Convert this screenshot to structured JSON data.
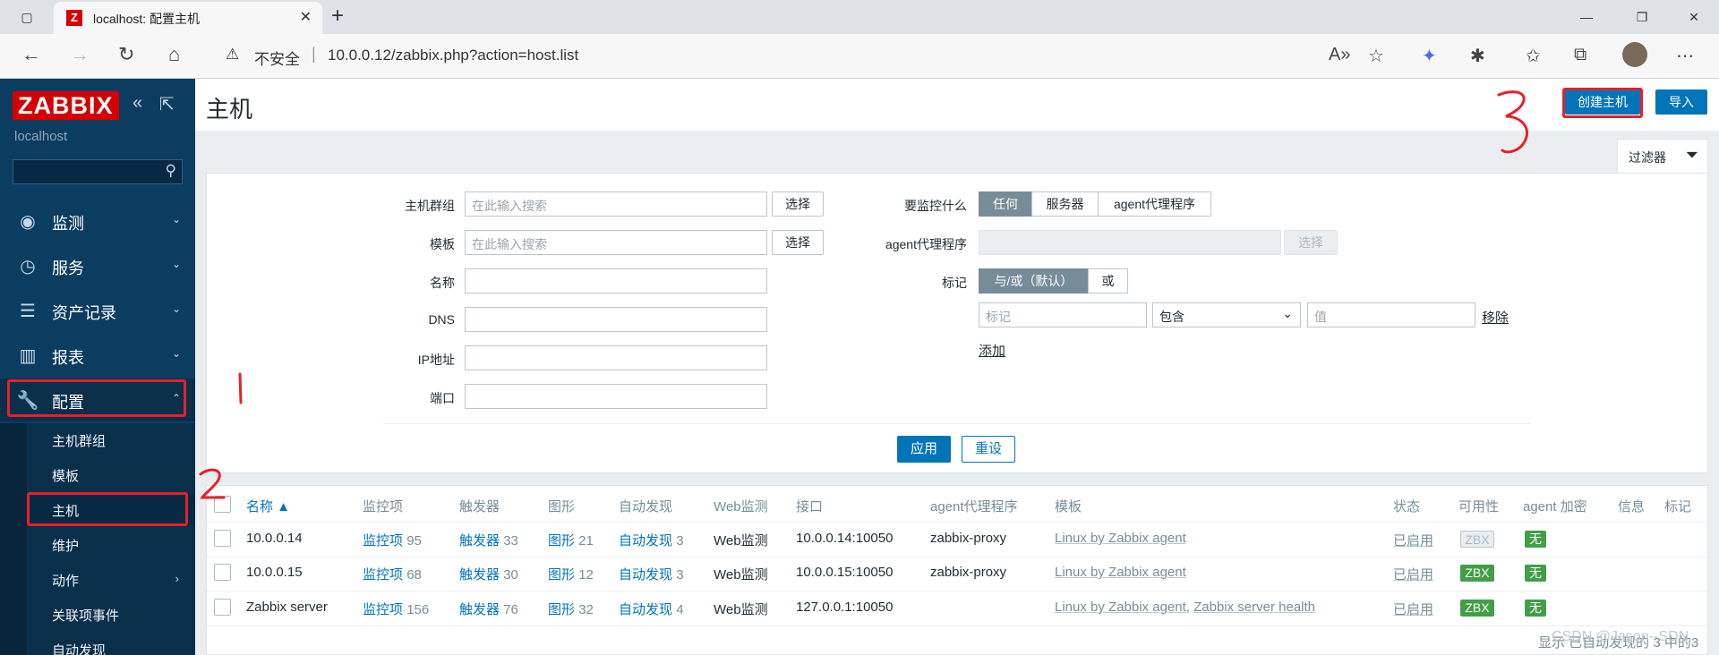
{
  "browser": {
    "tab_title": "localhost: 配置主机",
    "tab_favicon": "Z",
    "security_label": "不安全",
    "url": "10.0.0.12/zabbix.php?action=host.list"
  },
  "sidebar": {
    "logo": "ZABBIX",
    "server": "localhost",
    "menu": [
      {
        "label": "监测",
        "icon": "eye-icon"
      },
      {
        "label": "服务",
        "icon": "clock-icon"
      },
      {
        "label": "资产记录",
        "icon": "list-icon"
      },
      {
        "label": "报表",
        "icon": "bar-chart-icon"
      },
      {
        "label": "配置",
        "icon": "wrench-icon"
      }
    ],
    "submenu": [
      "主机群组",
      "模板",
      "主机",
      "维护",
      "动作",
      "关联项事件",
      "自动发现"
    ]
  },
  "header": {
    "title": "主机",
    "create_host": "创建主机",
    "import": "导入"
  },
  "filter": {
    "tab_label": "过滤器",
    "host_groups_label": "主机群组",
    "templates_label": "模板",
    "name_label": "名称",
    "dns_label": "DNS",
    "ip_label": "IP地址",
    "port_label": "端口",
    "search_placeholder": "在此输入搜索",
    "select": "选择",
    "monitored_by_label": "要监控什么",
    "monitored_by_options": [
      "任何",
      "服务器",
      "agent代理程序"
    ],
    "proxy_label": "agent代理程序",
    "tags_label": "标记",
    "tag_mode": [
      "与/或（默认）",
      "或"
    ],
    "tag_placeholder": "标记",
    "tag_operator": "包含",
    "value_placeholder": "值",
    "remove": "移除",
    "add": "添加",
    "apply": "应用",
    "reset": "重设"
  },
  "table": {
    "headers": [
      "名称 ▲",
      "监控项",
      "触发器",
      "图形",
      "自动发现",
      "Web监测",
      "接口",
      "agent代理程序",
      "模板",
      "状态",
      "可用性",
      "agent 加密",
      "信息",
      "标记"
    ],
    "rows": [
      {
        "name": "10.0.0.14",
        "items_label": "监控项",
        "items": "95",
        "triggers_label": "触发器",
        "triggers": "33",
        "graphs_label": "图形",
        "graphs": "21",
        "discovery_label": "自动发现",
        "discovery": "3",
        "web": "Web监测",
        "interface": "10.0.0.14:10050",
        "proxy": "zabbix-proxy",
        "template1": "Linux by Zabbix agent",
        "template2": "",
        "status": "已启用",
        "zbx": "ZBX",
        "zbx_state": "unknown",
        "enc": "无"
      },
      {
        "name": "10.0.0.15",
        "items_label": "监控项",
        "items": "68",
        "triggers_label": "触发器",
        "triggers": "30",
        "graphs_label": "图形",
        "graphs": "12",
        "discovery_label": "自动发现",
        "discovery": "3",
        "web": "Web监测",
        "interface": "10.0.0.15:10050",
        "proxy": "zabbix-proxy",
        "template1": "Linux by Zabbix agent",
        "template2": "",
        "status": "已启用",
        "zbx": "ZBX",
        "zbx_state": "available",
        "enc": "无"
      },
      {
        "name": "Zabbix server",
        "items_label": "监控项",
        "items": "156",
        "triggers_label": "触发器",
        "triggers": "76",
        "graphs_label": "图形",
        "graphs": "32",
        "discovery_label": "自动发现",
        "discovery": "4",
        "web": "Web监测",
        "interface": "127.0.0.1:10050",
        "proxy": "",
        "template1": "Linux by Zabbix agent",
        "template2": "Zabbix server health",
        "status": "已启用",
        "zbx": "ZBX",
        "zbx_state": "available",
        "enc": "无"
      }
    ],
    "footer": "显示 已自动发现的 3 中的3",
    "watermark": "CSDN @Jason--SDN"
  },
  "annotations": [
    "1",
    "2",
    "3"
  ],
  "colors": {
    "brand_red": "#d40000",
    "sidebar": "#0b3d61",
    "primary": "#0275b8",
    "green": "#429e47",
    "highlight": "#e5202a"
  }
}
